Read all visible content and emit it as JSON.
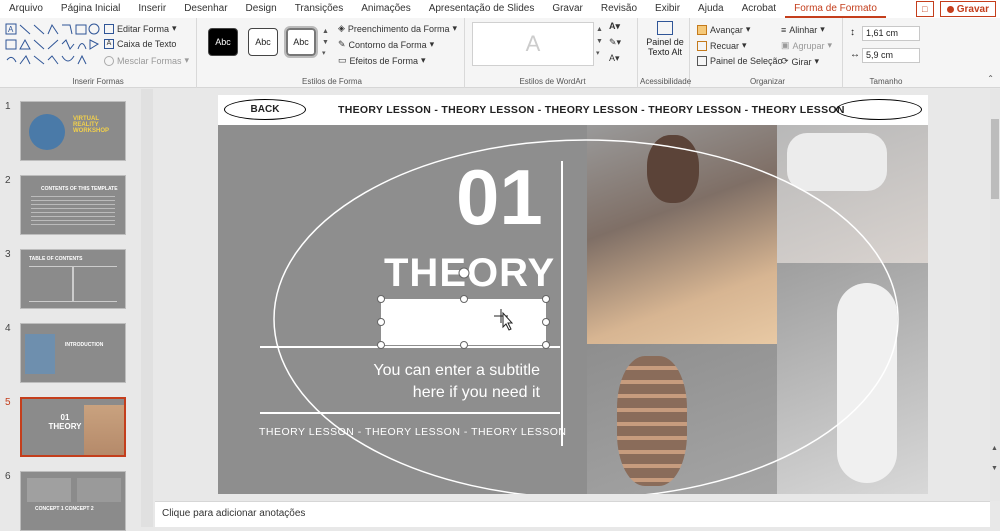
{
  "tabs": [
    "Arquivo",
    "Página Inicial",
    "Inserir",
    "Desenhar",
    "Design",
    "Transições",
    "Animações",
    "Apresentação de Slides",
    "Gravar",
    "Revisão",
    "Exibir",
    "Ajuda",
    "Acrobat",
    "Forma de Formato"
  ],
  "record_label": "Gravar",
  "ribbon": {
    "insert_shapes": {
      "edit_shape": "Editar Forma",
      "text_box": "Caixa de Texto",
      "merge_shapes": "Mesclar Formas",
      "label": "Inserir Formas"
    },
    "shape_styles": {
      "abc": "Abc",
      "fill": "Preenchimento da Forma",
      "outline": "Contorno da Forma",
      "effects": "Efeitos de Forma",
      "label": "Estilos de Forma"
    },
    "wordart": {
      "glyph": "A",
      "label": "Estilos de WordArt"
    },
    "accessibility": {
      "alt_text_line1": "Painel de",
      "alt_text_line2": "Texto Alt",
      "label": "Acessibilidade"
    },
    "arrange": {
      "bring_forward": "Avançar",
      "send_backward": "Recuar",
      "selection_pane": "Painel de Seleção",
      "align": "Alinhar",
      "group": "Agrupar",
      "rotate": "Girar",
      "label": "Organizar"
    },
    "size": {
      "height": "1,61 cm",
      "width": "5,9 cm",
      "label": "Tamanho"
    }
  },
  "thumbnails": [
    {
      "num": "1",
      "title": "VIRTUAL REALITY WORKSHOP"
    },
    {
      "num": "2",
      "title": "CONTENTS OF THIS TEMPLATE"
    },
    {
      "num": "3",
      "title": "TABLE OF CONTENTS"
    },
    {
      "num": "4",
      "title": "INTRODUCTION"
    },
    {
      "num": "5",
      "title": "01 THEORY"
    },
    {
      "num": "6",
      "title": "CONCEPT 1   CONCEPT 2"
    }
  ],
  "slide": {
    "back": "BACK",
    "banner": "THEORY LESSON - THEORY LESSON - THEORY LESSON - THEORY LESSON - THEORY LESSON",
    "number": "01",
    "title": "THEORY",
    "subtitle_line1": "You can enter a subtitle",
    "subtitle_line2": "here if you need it",
    "footer": "THEORY LESSON - THEORY LESSON - THEORY LESSON"
  },
  "notes_placeholder": "Clique para adicionar anotações",
  "colors": {
    "accent": "#c43e1c",
    "slide_gray": "#8e8e8e"
  }
}
